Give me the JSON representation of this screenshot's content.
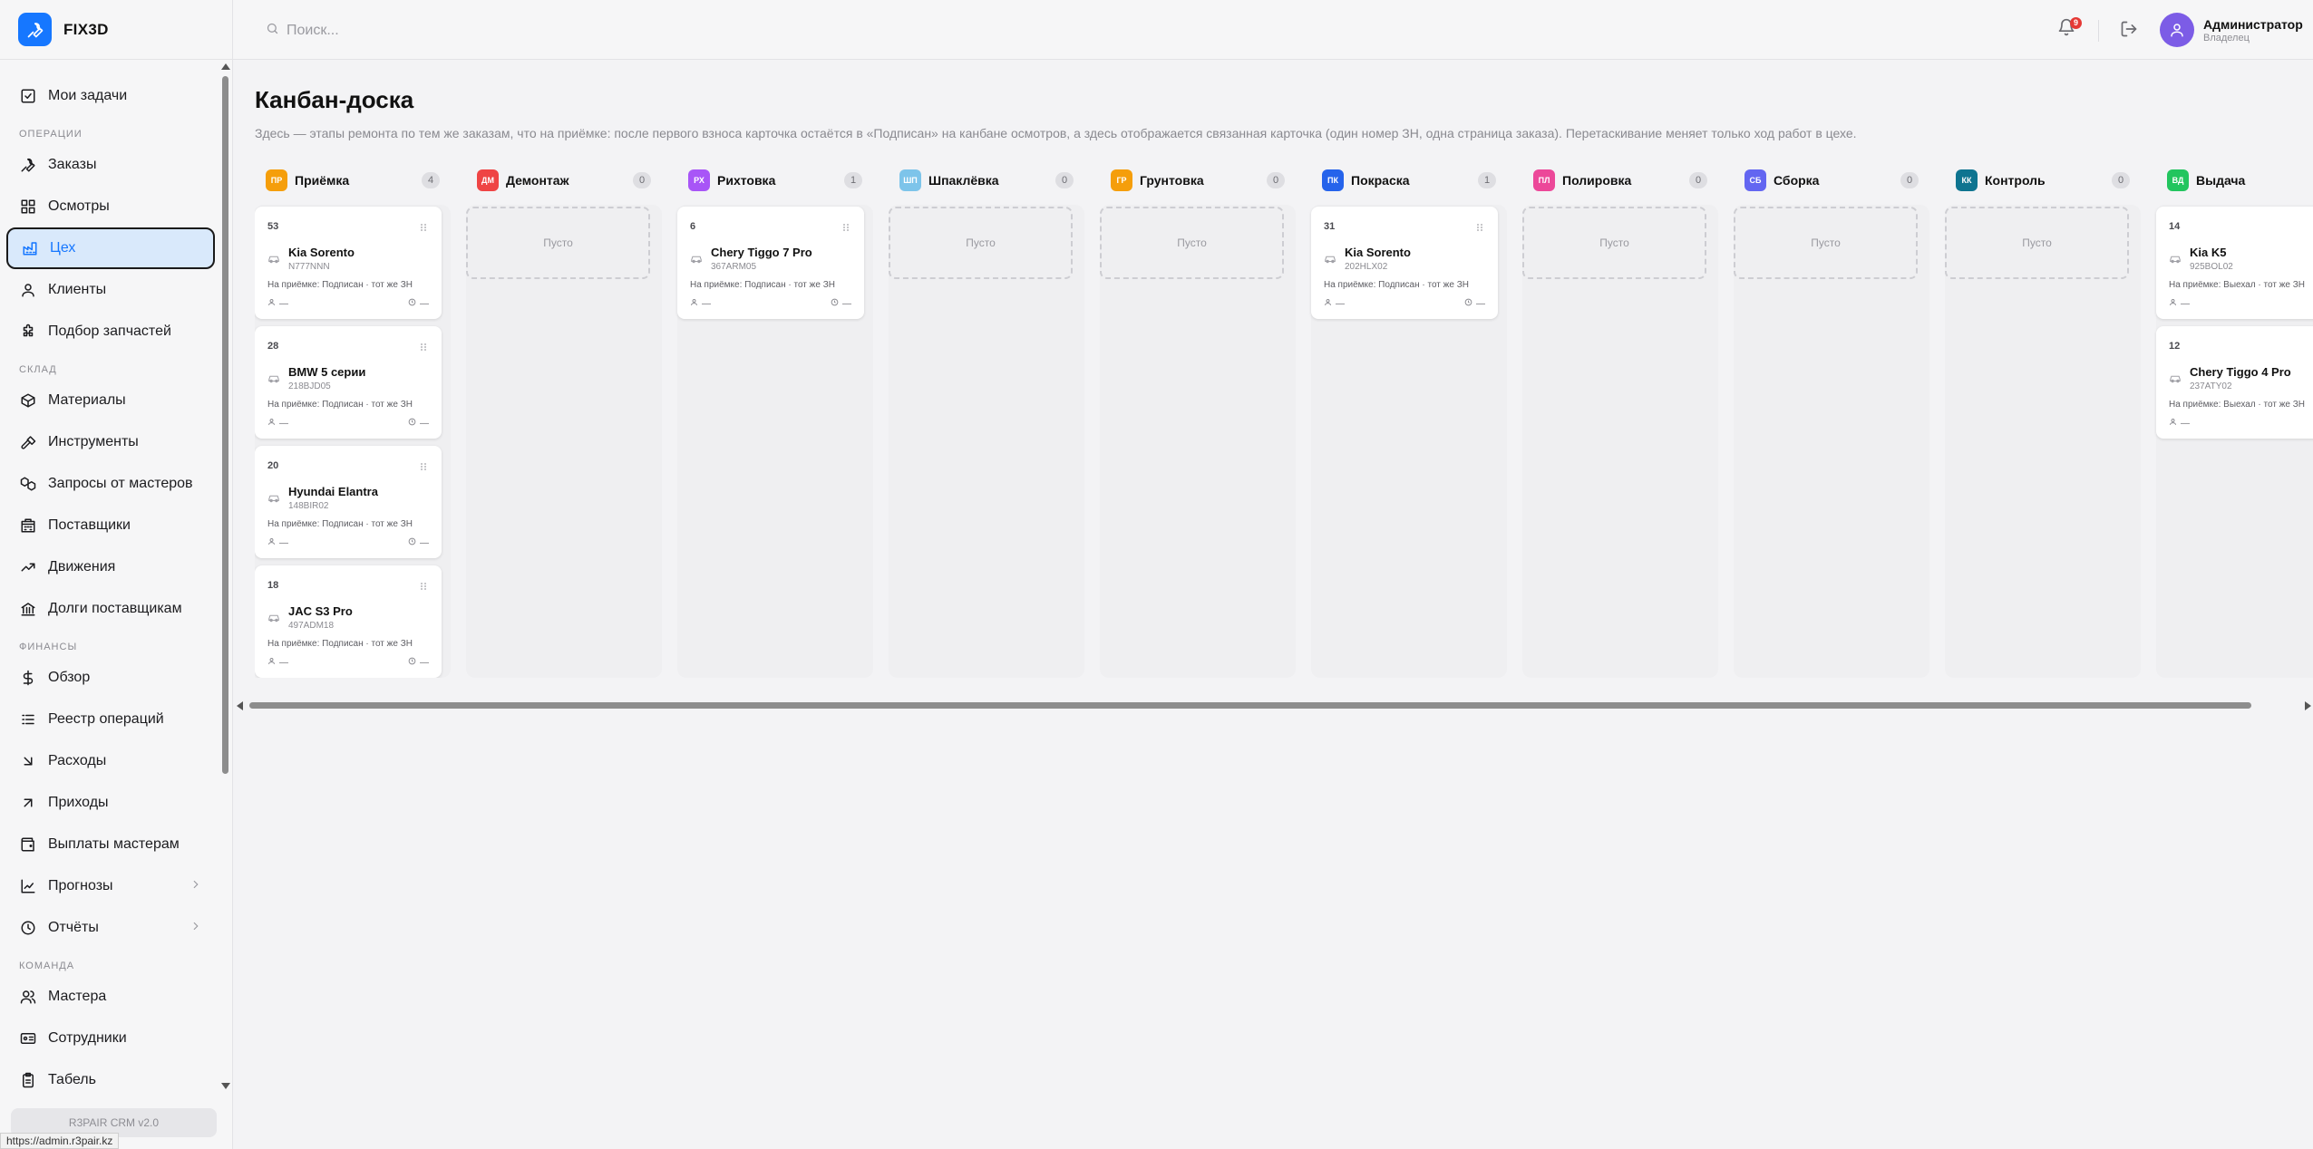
{
  "app": {
    "name": "FIX3D",
    "version": "R3PAIR CRM v2.0",
    "status_url": "https://admin.r3pair.kz"
  },
  "header": {
    "search_placeholder": "Поиск...",
    "notifications_count": "9",
    "user": {
      "name": "Администратор",
      "role": "Владелец"
    }
  },
  "sidebar": {
    "top": {
      "label": "Мои задачи",
      "icon": "check-square-icon"
    },
    "sections": [
      {
        "title": "Операции",
        "items": [
          {
            "label": "Заказы",
            "icon": "wrench-icon"
          },
          {
            "label": "Осмотры",
            "icon": "grid-icon"
          },
          {
            "label": "Цех",
            "icon": "factory-icon",
            "active": true
          },
          {
            "label": "Клиенты",
            "icon": "user-icon"
          },
          {
            "label": "Подбор запчастей",
            "icon": "puzzle-icon"
          }
        ]
      },
      {
        "title": "Склад",
        "items": [
          {
            "label": "Материалы",
            "icon": "box-icon"
          },
          {
            "label": "Инструменты",
            "icon": "hammer-icon"
          },
          {
            "label": "Запросы от мастеров",
            "icon": "boxes-icon"
          },
          {
            "label": "Поставщики",
            "icon": "building-icon"
          },
          {
            "label": "Движения",
            "icon": "trend-icon"
          },
          {
            "label": "Долги поставщикам",
            "icon": "bank-icon"
          }
        ]
      },
      {
        "title": "Финансы",
        "items": [
          {
            "label": "Обзор",
            "icon": "dollar-icon"
          },
          {
            "label": "Реестр операций",
            "icon": "list-icon"
          },
          {
            "label": "Расходы",
            "icon": "arrow-down-right-icon"
          },
          {
            "label": "Приходы",
            "icon": "arrow-up-right-icon"
          },
          {
            "label": "Выплаты мастерам",
            "icon": "wallet-icon"
          },
          {
            "label": "Прогнозы",
            "icon": "chart-icon",
            "chevron": true
          },
          {
            "label": "Отчёты",
            "icon": "clock-icon",
            "chevron": true
          }
        ]
      },
      {
        "title": "Команда",
        "items": [
          {
            "label": "Мастера",
            "icon": "users-icon"
          },
          {
            "label": "Сотрудники",
            "icon": "id-card-icon"
          },
          {
            "label": "Табель",
            "icon": "clipboard-icon"
          }
        ]
      }
    ]
  },
  "page": {
    "title": "Канбан-доска",
    "description": "Здесь — этапы ремонта по тем же заказам, что на приёмке: после первого взноса карточка остаётся в «Подписан» на канбане осмотров, а здесь отображается связанная карточка (один номер ЗН, одна страница заказа). Перетаскивание меняет только ход работ в цехе."
  },
  "empty_label": "Пусто",
  "columns": [
    {
      "abbr": "ПР",
      "name": "Приёмка",
      "count": "4",
      "color": "#f59e0b",
      "cards": [
        {
          "num": "53",
          "model": "Kia Sorento",
          "plate": "N777NNN",
          "status": "На приёмке: Подписан · тот же ЗН",
          "master": "—",
          "time": "—"
        },
        {
          "num": "28",
          "model": "BMW 5 серии",
          "plate": "218BJD05",
          "status": "На приёмке: Подписан · тот же ЗН",
          "master": "—",
          "time": "—"
        },
        {
          "num": "20",
          "model": "Hyundai Elantra",
          "plate": "148BIR02",
          "status": "На приёмке: Подписан · тот же ЗН",
          "master": "—",
          "time": "—"
        },
        {
          "num": "18",
          "model": "JAC S3 Pro",
          "plate": "497ADM18",
          "status": "На приёмке: Подписан · тот же ЗН",
          "master": "—",
          "time": "—"
        }
      ]
    },
    {
      "abbr": "ДМ",
      "name": "Демонтаж",
      "count": "0",
      "color": "#ef4444",
      "cards": []
    },
    {
      "abbr": "РХ",
      "name": "Рихтовка",
      "count": "1",
      "color": "#a855f7",
      "cards": [
        {
          "num": "6",
          "model": "Chery Tiggo 7 Pro",
          "plate": "367ARM05",
          "status": "На приёмке: Подписан · тот же ЗН",
          "master": "—",
          "time": "—"
        }
      ]
    },
    {
      "abbr": "ШП",
      "name": "Шпаклёвка",
      "count": "0",
      "color": "#7dc4ea",
      "cards": []
    },
    {
      "abbr": "ГР",
      "name": "Грунтовка",
      "count": "0",
      "color": "#f59e0b",
      "cards": []
    },
    {
      "abbr": "ПК",
      "name": "Покраска",
      "count": "1",
      "color": "#2563eb",
      "cards": [
        {
          "num": "31",
          "model": "Kia Sorento",
          "plate": "202HLX02",
          "status": "На приёмке: Подписан · тот же ЗН",
          "master": "—",
          "time": "—"
        }
      ]
    },
    {
      "abbr": "ПЛ",
      "name": "Полировка",
      "count": "0",
      "color": "#ec4899",
      "cards": []
    },
    {
      "abbr": "СБ",
      "name": "Сборка",
      "count": "0",
      "color": "#6366f1",
      "cards": []
    },
    {
      "abbr": "КК",
      "name": "Контроль",
      "count": "0",
      "color": "#0e7490",
      "cards": []
    },
    {
      "abbr": "ВД",
      "name": "Выдача",
      "count": "",
      "color": "#22c55e",
      "cards": [
        {
          "num": "14",
          "model": "Kia K5",
          "plate": "925BOL02",
          "status": "На приёмке: Выехал · тот же ЗН",
          "master": "—",
          "time": ""
        },
        {
          "num": "12",
          "model": "Chery Tiggo 4 Pro",
          "plate": "237ATY02",
          "status": "На приёмке: Выехал · тот же ЗН",
          "master": "—",
          "time": ""
        }
      ]
    }
  ]
}
